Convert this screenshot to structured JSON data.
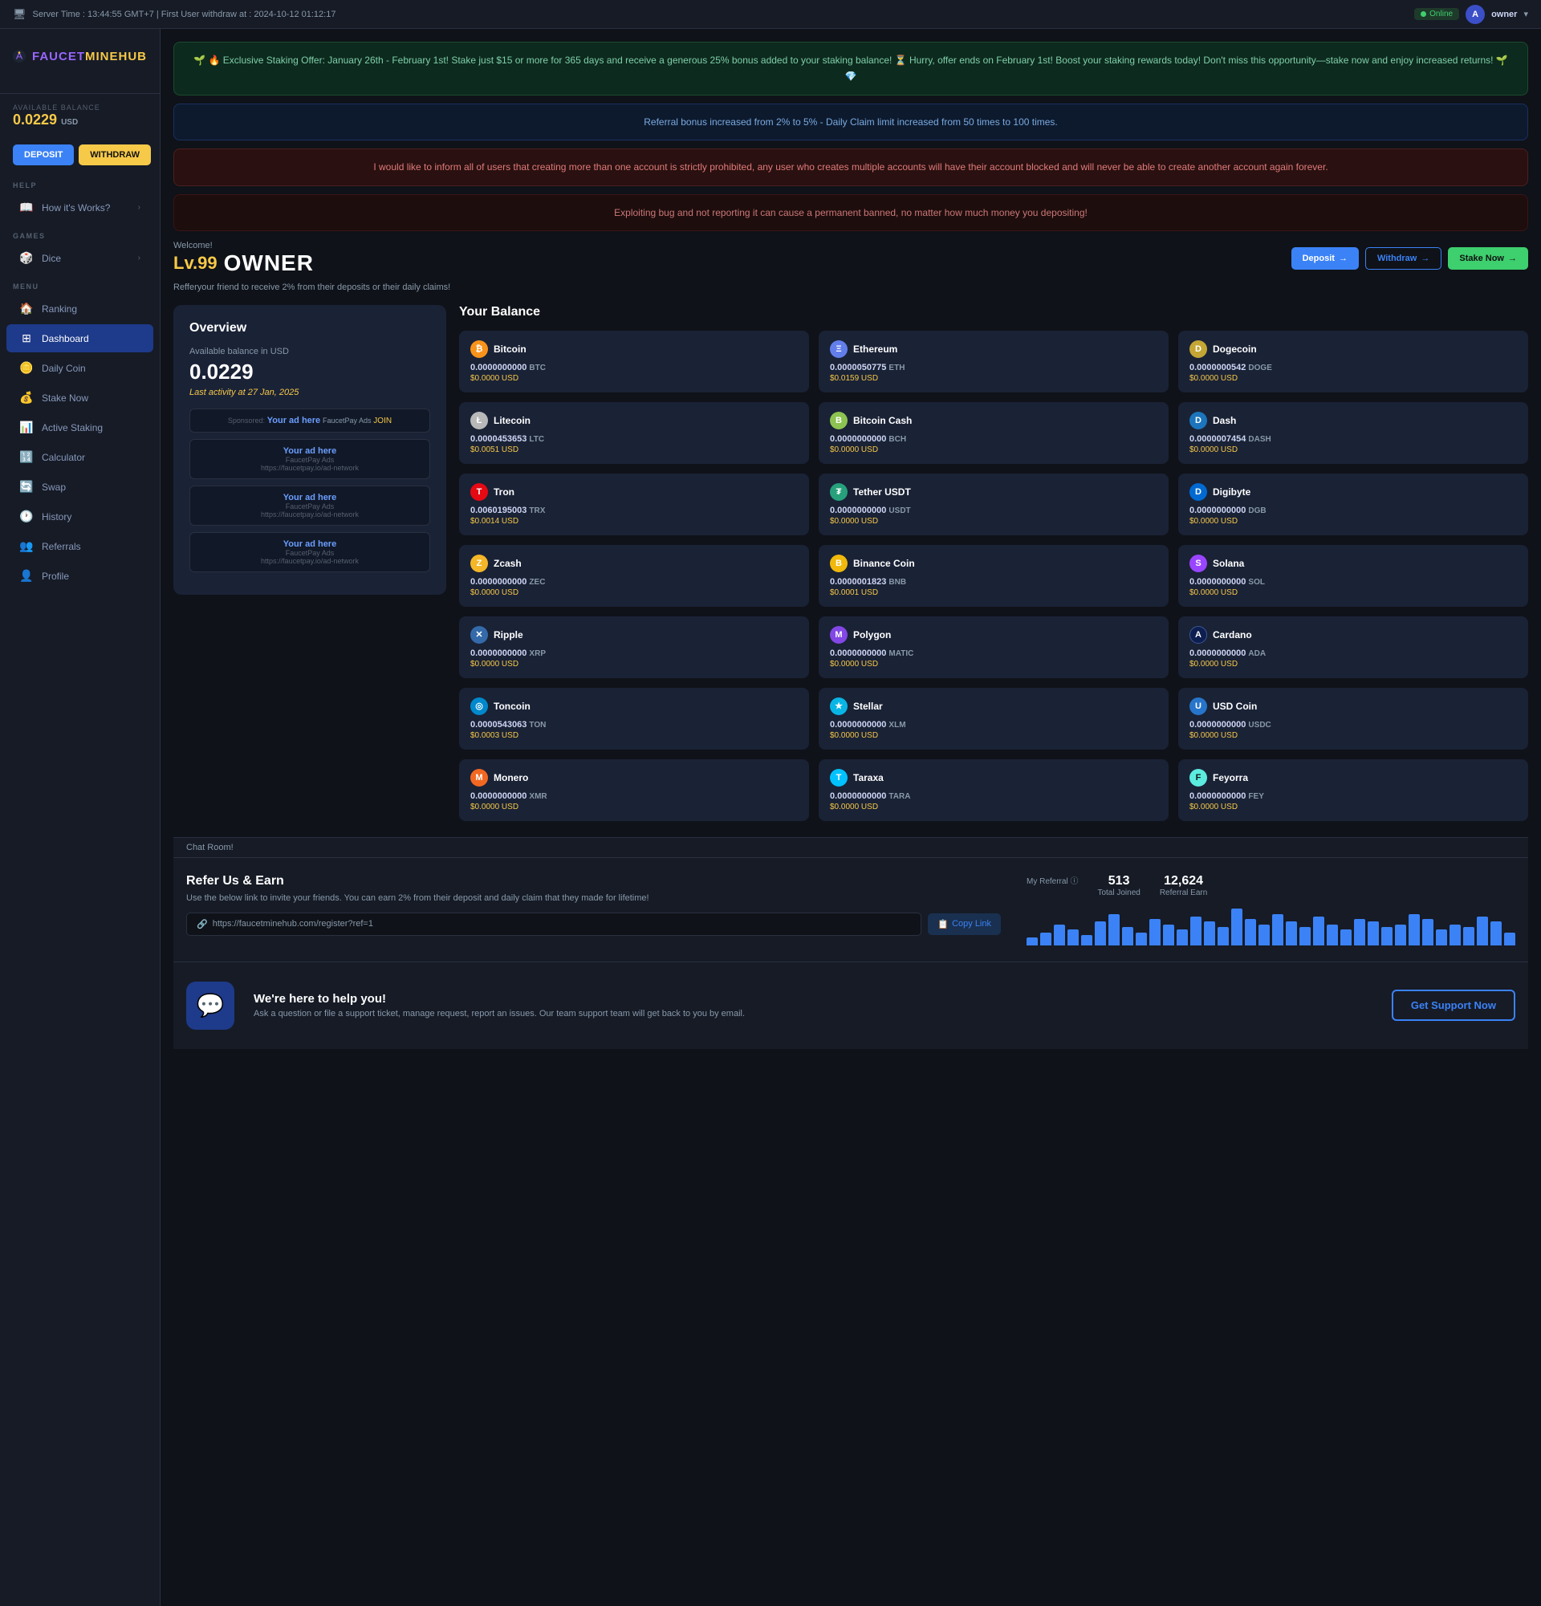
{
  "topbar": {
    "server_time": "Server Time : 13:44:55 GMT+7 | First User withdraw at : 2024-10-12 01:12:17",
    "online_label": "Online",
    "user_label": "owner",
    "avatar_initial": "A"
  },
  "sidebar": {
    "logo_text_part1": "FAUCET",
    "logo_text_part2": "MINEHUB",
    "balance_label": "AVAILABLE BALANCE",
    "balance_value": "0.0229",
    "balance_currency": "USD",
    "deposit_label": "DEPOSIT",
    "withdraw_label": "WITHDRAW",
    "help_label": "HELP",
    "how_it_works_label": "How it's Works?",
    "games_label": "GAMES",
    "dice_label": "Dice",
    "menu_label": "MENU",
    "ranking_label": "Ranking",
    "dashboard_label": "Dashboard",
    "daily_coin_label": "Daily Coin",
    "stake_now_label": "Stake Now",
    "active_staking_label": "Active Staking",
    "calculator_label": "Calculator",
    "swap_label": "Swap",
    "history_label": "History",
    "referrals_label": "Referrals",
    "profile_label": "Profile"
  },
  "banners": {
    "staking_offer": "🌱 🔥 Exclusive Staking Offer: January 26th - February 1st! Stake just $15 or more for 365 days and receive a generous 25% bonus added to your staking balance! ⏳ Hurry, offer ends on February 1st! Boost your staking rewards today! Don't miss this opportunity—stake now and enjoy increased returns! 🌱 💎",
    "referral_bonus": "Referral bonus increased from 2% to 5% - Daily Claim limit increased from 50 times to 100 times.",
    "multi_account": "I would like to inform all of users that creating more than one account is strictly prohibited, any user who creates multiple accounts will have their account blocked and will never be able to create another account again forever.",
    "exploit_warning": "Exploiting bug and not reporting it can cause a permanent banned, no matter how much money you depositing!"
  },
  "welcome": {
    "welcome_text": "Welcome!",
    "level": "Lv.99",
    "owner": "OWNER",
    "referral_info": "Refferyour friend to receive 2% from their deposits or their daily claims!",
    "deposit_label": "Deposit",
    "withdraw_label": "Withdraw",
    "stake_now_label": "Stake Now"
  },
  "overview": {
    "title": "Overview",
    "balance_label": "Available balance in USD",
    "balance_value": "0.0229",
    "last_activity": "Last activity at 27 Jan, 2025",
    "ad_sponsored": "Sponsored: Your ad here FaucetPay Ads JOIN",
    "ads": [
      {
        "link": "Your ad here",
        "network": "FaucetPay Ads",
        "url": "https://faucetpay.io/ad-network"
      },
      {
        "link": "Your ad here",
        "network": "FaucetPay Ads",
        "url": "https://faucetpay.io/ad-network"
      },
      {
        "link": "Your ad here",
        "network": "FaucetPay Ads",
        "url": "https://faucetpay.io/ad-network"
      }
    ]
  },
  "your_balance": {
    "title": "Your Balance",
    "coins": [
      {
        "name": "Bitcoin",
        "ticker": "BTC",
        "amount": "0.0000000000",
        "usd": "$0.0000 USD",
        "color_class": "coin-btc",
        "symbol": "₿"
      },
      {
        "name": "Ethereum",
        "ticker": "ETH",
        "amount": "0.0000050775",
        "usd": "$0.0159 USD",
        "color_class": "coin-eth",
        "symbol": "Ξ"
      },
      {
        "name": "Dogecoin",
        "ticker": "DOGE",
        "amount": "0.0000000542",
        "usd": "$0.0000 USD",
        "color_class": "coin-doge",
        "symbol": "D"
      },
      {
        "name": "Litecoin",
        "ticker": "LTC",
        "amount": "0.0000453653",
        "usd": "$0.0051 USD",
        "color_class": "coin-ltc",
        "symbol": "Ł"
      },
      {
        "name": "Bitcoin Cash",
        "ticker": "BCH",
        "amount": "0.0000000000",
        "usd": "$0.0000 USD",
        "color_class": "coin-bch",
        "symbol": "B"
      },
      {
        "name": "Dash",
        "ticker": "DASH",
        "amount": "0.0000007454",
        "usd": "$0.0000 USD",
        "color_class": "coin-dash",
        "symbol": "D"
      },
      {
        "name": "Tron",
        "ticker": "TRX",
        "amount": "0.0060195003",
        "usd": "$0.0014 USD",
        "color_class": "coin-trx",
        "symbol": "T"
      },
      {
        "name": "Tether USDT",
        "ticker": "USDT",
        "amount": "0.0000000000",
        "usd": "$0.0000 USD",
        "color_class": "coin-usdt",
        "symbol": "₮"
      },
      {
        "name": "Digibyte",
        "ticker": "DGB",
        "amount": "0.0000000000",
        "usd": "$0.0000 USD",
        "color_class": "coin-dgb",
        "symbol": "D"
      },
      {
        "name": "Zcash",
        "ticker": "ZEC",
        "amount": "0.0000000000",
        "usd": "$0.0000 USD",
        "color_class": "coin-zec",
        "symbol": "Z"
      },
      {
        "name": "Binance Coin",
        "ticker": "BNB",
        "amount": "0.0000001823",
        "usd": "$0.0001 USD",
        "color_class": "coin-bnb",
        "symbol": "B"
      },
      {
        "name": "Solana",
        "ticker": "SOL",
        "amount": "0.0000000000",
        "usd": "$0.0000 USD",
        "color_class": "coin-sol",
        "symbol": "S"
      },
      {
        "name": "Ripple",
        "ticker": "XRP",
        "amount": "0.0000000000",
        "usd": "$0.0000 USD",
        "color_class": "coin-xrp",
        "symbol": "✕"
      },
      {
        "name": "Polygon",
        "ticker": "MATIC",
        "amount": "0.0000000000",
        "usd": "$0.0000 USD",
        "color_class": "coin-matic",
        "symbol": "M"
      },
      {
        "name": "Cardano",
        "ticker": "ADA",
        "amount": "0.0000000000",
        "usd": "$0.0000 USD",
        "color_class": "coin-ada",
        "symbol": "A"
      },
      {
        "name": "Toncoin",
        "ticker": "TON",
        "amount": "0.0000543063",
        "usd": "$0.0003 USD",
        "color_class": "coin-ton",
        "symbol": "◎"
      },
      {
        "name": "Stellar",
        "ticker": "XLM",
        "amount": "0.0000000000",
        "usd": "$0.0000 USD",
        "color_class": "coin-xlm",
        "symbol": "★"
      },
      {
        "name": "USD Coin",
        "ticker": "USDC",
        "amount": "0.0000000000",
        "usd": "$0.0000 USD",
        "color_class": "coin-usdc",
        "symbol": "U"
      },
      {
        "name": "Monero",
        "ticker": "XMR",
        "amount": "0.0000000000",
        "usd": "$0.0000 USD",
        "color_class": "coin-xmr",
        "symbol": "M"
      },
      {
        "name": "Taraxa",
        "ticker": "TARA",
        "amount": "0.0000000000",
        "usd": "$0.0000 USD",
        "color_class": "coin-tara",
        "symbol": "T"
      },
      {
        "name": "Feyorra",
        "ticker": "FEY",
        "amount": "0.0000000000",
        "usd": "$0.0000 USD",
        "color_class": "coin-fey",
        "symbol": "F"
      }
    ]
  },
  "chat_room": {
    "label": "Chat Room!"
  },
  "refer": {
    "title": "Refer Us & Earn",
    "description": "Use the below link to invite your friends. You can earn 2% from their deposit and daily claim that they made for lifetime!",
    "link": "https://faucetminehub.com/register?ref=1",
    "copy_label": "Copy Link",
    "my_referral_label": "My Referral ⓘ",
    "total_joined_label": "Total Joined",
    "total_joined_value": "513",
    "referral_earn_label": "Referral Earn",
    "referral_earn_value": "12,624",
    "chart_bars": [
      3,
      5,
      8,
      6,
      4,
      9,
      12,
      7,
      5,
      10,
      8,
      6,
      11,
      9,
      7,
      14,
      10,
      8,
      12,
      9,
      7,
      11,
      8,
      6,
      10,
      9,
      7,
      8,
      12,
      10,
      6,
      8,
      7,
      11,
      9,
      5
    ]
  },
  "support": {
    "title": "We're here to help you!",
    "description": "Ask a question or file a support ticket, manage request, report an issues. Our team support team will get back to you by email.",
    "button_label": "Get Support Now"
  }
}
